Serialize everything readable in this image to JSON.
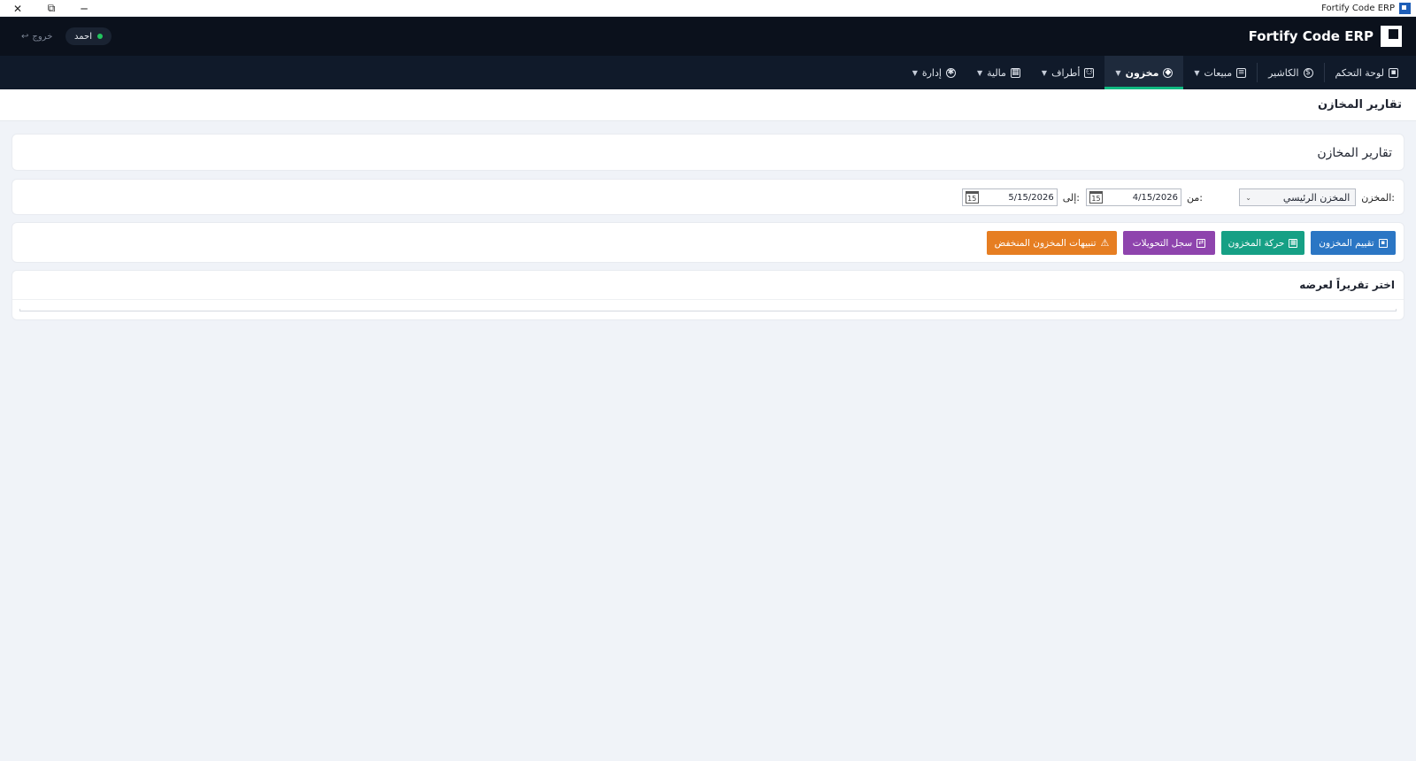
{
  "window": {
    "title": "Fortify Code ERP",
    "close_glyph": "✕",
    "restore_glyph": "⧉",
    "minimize_glyph": "─"
  },
  "header": {
    "brand": "Fortify Code ERP",
    "user_name": "احمد",
    "logout_label": "خروج",
    "logout_icon": "↩"
  },
  "nav": {
    "items": [
      {
        "label": "لوحة التحكم",
        "icon": "dashboard-icon"
      },
      {
        "label": "الكاشير",
        "icon": "cashier-icon"
      },
      {
        "label": "مبيعات",
        "icon": "receipt-icon"
      },
      {
        "label": "مخزون",
        "icon": "box-icon"
      },
      {
        "label": "أطراف",
        "icon": "people-icon"
      },
      {
        "label": "مالية",
        "icon": "ledger-icon"
      },
      {
        "label": "إدارة",
        "icon": "gear-icon"
      }
    ],
    "active": "مخزون"
  },
  "page": {
    "title": "تقارير المخازن",
    "section_title": "تقارير المخازن"
  },
  "filters": {
    "warehouse_label": "المخزن:",
    "warehouse_value": "المخزن الرئيسي",
    "from_label": "من:",
    "from_value": "4/15/2026",
    "to_label": "إلى:",
    "to_value": "5/15/2026",
    "calendar_day": "15"
  },
  "reports": {
    "valuation": "تقييم المخزون",
    "movement": "حركة المخزون",
    "transfers": "سجل التحويلات",
    "low_stock": "تنبيهات المخزون المنخفض"
  },
  "result": {
    "placeholder": "اختر تقريراً لعرضه"
  },
  "colors": {
    "header_bg": "#0b111c",
    "nav_bg": "#101a2a",
    "active_accent": "#10b981",
    "btn_blue": "#2b76c4",
    "btn_green": "#16a085",
    "btn_purple": "#8e44ad",
    "btn_orange": "#e67e22"
  }
}
